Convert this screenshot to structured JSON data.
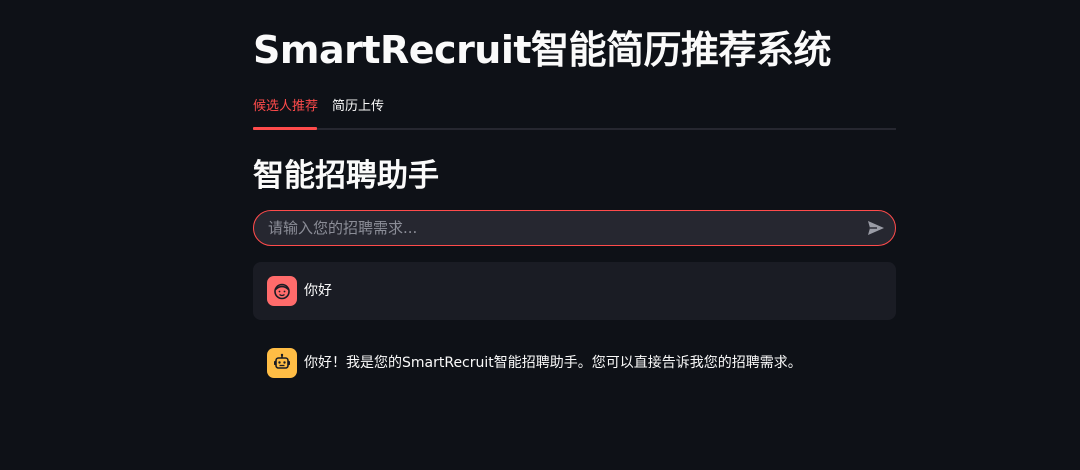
{
  "app": {
    "title": "SmartRecruit智能简历推荐系统"
  },
  "tabs": [
    {
      "label": "候选人推荐",
      "active": true
    },
    {
      "label": "简历上传",
      "active": false
    }
  ],
  "section": {
    "title": "智能招聘助手"
  },
  "chat_input": {
    "placeholder": "请输入您的招聘需求...",
    "value": ""
  },
  "messages": [
    {
      "role": "user",
      "avatar_icon": "user-face-icon",
      "text": "你好"
    },
    {
      "role": "assistant",
      "avatar_icon": "robot-icon",
      "text": "你好！我是您的SmartRecruit智能招聘助手。您可以直接告诉我您的招聘需求。"
    }
  ],
  "colors": {
    "background": "#0e1117",
    "accent": "#ff4b4b",
    "user_avatar": "#ff6b6b",
    "bot_avatar": "#ffbd45",
    "message_bg": "#1a1c24"
  }
}
